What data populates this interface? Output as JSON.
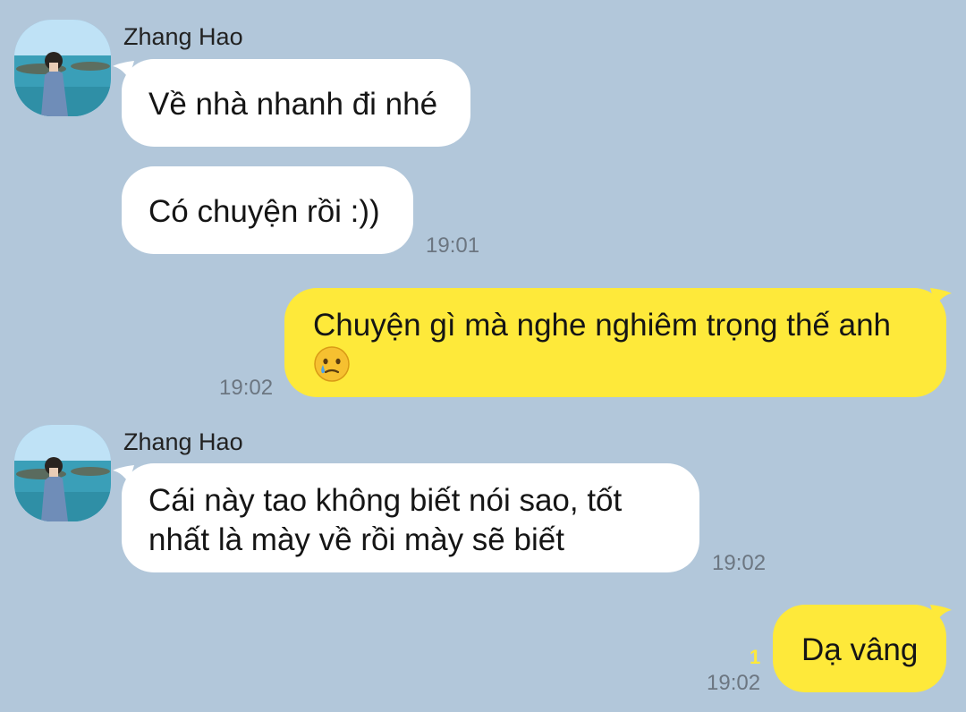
{
  "contact": {
    "name": "Zhang Hao"
  },
  "colors": {
    "background": "#b2c7da",
    "incoming_bubble": "#ffffff",
    "outgoing_bubble": "#fee93a",
    "timestamp": "#6c7681",
    "unread_count": "#fee93a"
  },
  "messages": [
    {
      "direction": "in",
      "sender": "Zhang Hao",
      "text": "Về nhà nhanh đi nhé"
    },
    {
      "direction": "in",
      "text": "Có chuyện rồi :))",
      "time": "19:01"
    },
    {
      "direction": "out",
      "text": "Chuyện gì mà nghe nghiêm trọng thế anh",
      "emoji": "crying-face-emoji",
      "time": "19:02"
    },
    {
      "direction": "in",
      "sender": "Zhang Hao",
      "text_line1": "Cái này tao không biết nói sao, tốt",
      "text_line2": "nhất là mày về rồi mày sẽ biết",
      "time": "19:02"
    },
    {
      "direction": "out",
      "text": "Dạ vâng",
      "unread": "1",
      "time": "19:02"
    }
  ]
}
